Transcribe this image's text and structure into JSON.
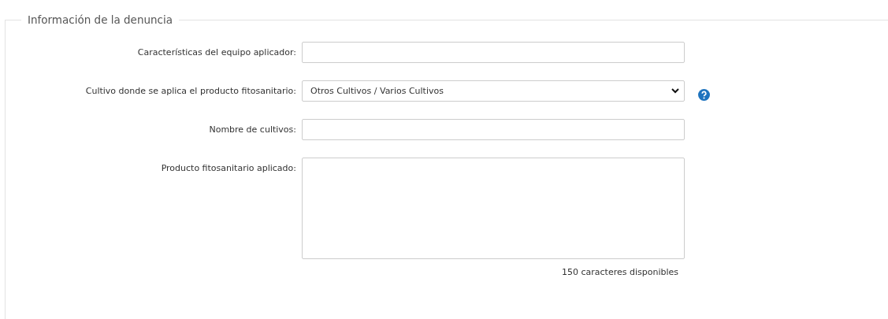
{
  "section": {
    "title": "Información de la denuncia"
  },
  "fields": [
    {
      "kind": "text",
      "label": "Características del equipo aplicador:"
    },
    {
      "kind": "select",
      "label": "Cultivo donde se aplica el producto fitosanitario:",
      "value": "Otros Cultivos / Varios Cultivos",
      "help": true
    },
    {
      "kind": "text",
      "label": "Nombre de cultivos:"
    },
    {
      "kind": "textarea",
      "label": "Producto fitosanitario aplicado:",
      "counter": "150 caracteres disponibles"
    }
  ]
}
